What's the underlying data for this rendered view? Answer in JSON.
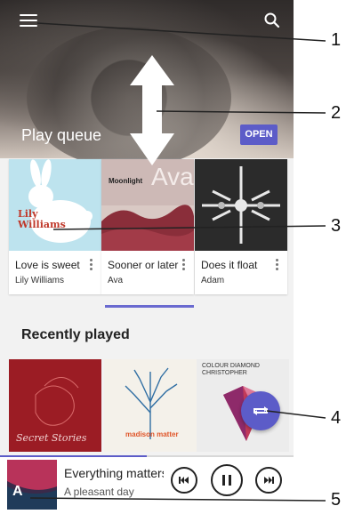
{
  "play_queue": {
    "title": "Play queue",
    "open_label": "OPEN",
    "items": [
      {
        "title": "Love is sweet",
        "artist": "Lily Williams",
        "cover_text": "Lily Williams"
      },
      {
        "title": "Sooner or later",
        "artist": "Ava",
        "cover_text": "Moonlight",
        "cover_big": "Ava"
      },
      {
        "title": "Does it float",
        "artist": "Adam"
      }
    ],
    "scroll_position": 0.5
  },
  "recently_played": {
    "title": "Recently played",
    "tiles": [
      {
        "cover_text": "Secret Stories"
      },
      {
        "cover_text": "madison matter"
      },
      {
        "cover_text": "COLOUR DIAMOND CHRISTOPHER"
      }
    ]
  },
  "now_playing": {
    "title": "Everything matters",
    "subtitle": "A pleasant day",
    "progress": 0.5
  },
  "callouts": [
    "1",
    "2",
    "3",
    "4",
    "5"
  ],
  "icons": {
    "menu": "menu-icon",
    "search": "search-icon",
    "shuffle": "shuffle-icon",
    "previous": "previous-icon",
    "pause": "pause-icon",
    "next": "next-icon"
  },
  "colors": {
    "accent": "#5c5cc8"
  }
}
